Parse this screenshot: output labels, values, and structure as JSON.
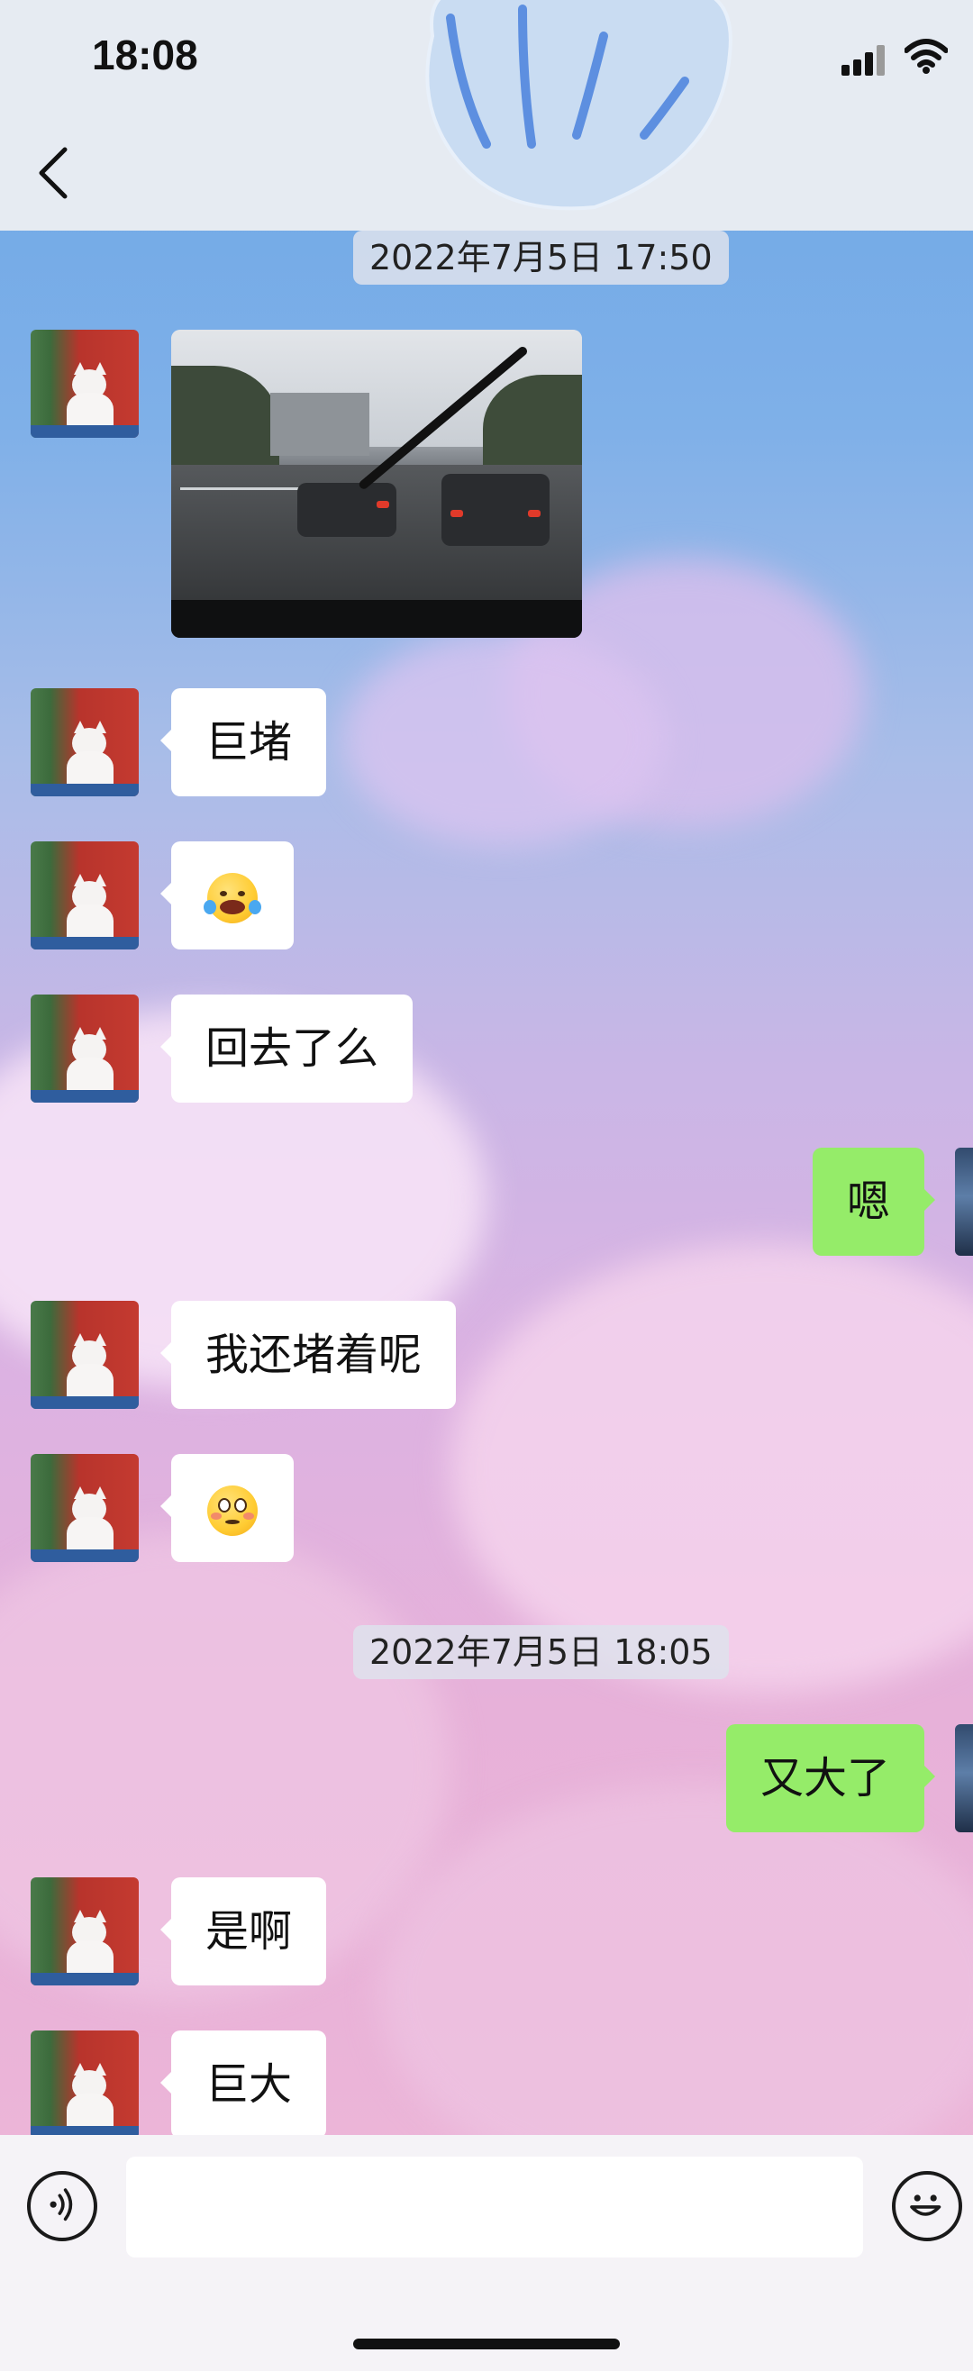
{
  "status_bar": {
    "time": "18:08",
    "signal_icon": "cellular-signal-icon",
    "wifi_icon": "wifi-icon"
  },
  "nav": {
    "back_icon": "chevron-left-icon"
  },
  "messages": {
    "ts1": "2022年7月5日 17:50",
    "m2": "巨堵",
    "m4": "回去了么",
    "m5": "嗯",
    "m6": "我还堵着呢",
    "ts2": "2022年7月5日 18:05",
    "m8": "又大了",
    "m9": "是啊",
    "m10": "巨大"
  },
  "input_bar": {
    "text_value": "",
    "voice_icon": "voice-icon",
    "emoji_icon": "emoji-icon"
  },
  "colors": {
    "outgoing_bubble": "#95ec69",
    "incoming_bubble": "#ffffff"
  }
}
